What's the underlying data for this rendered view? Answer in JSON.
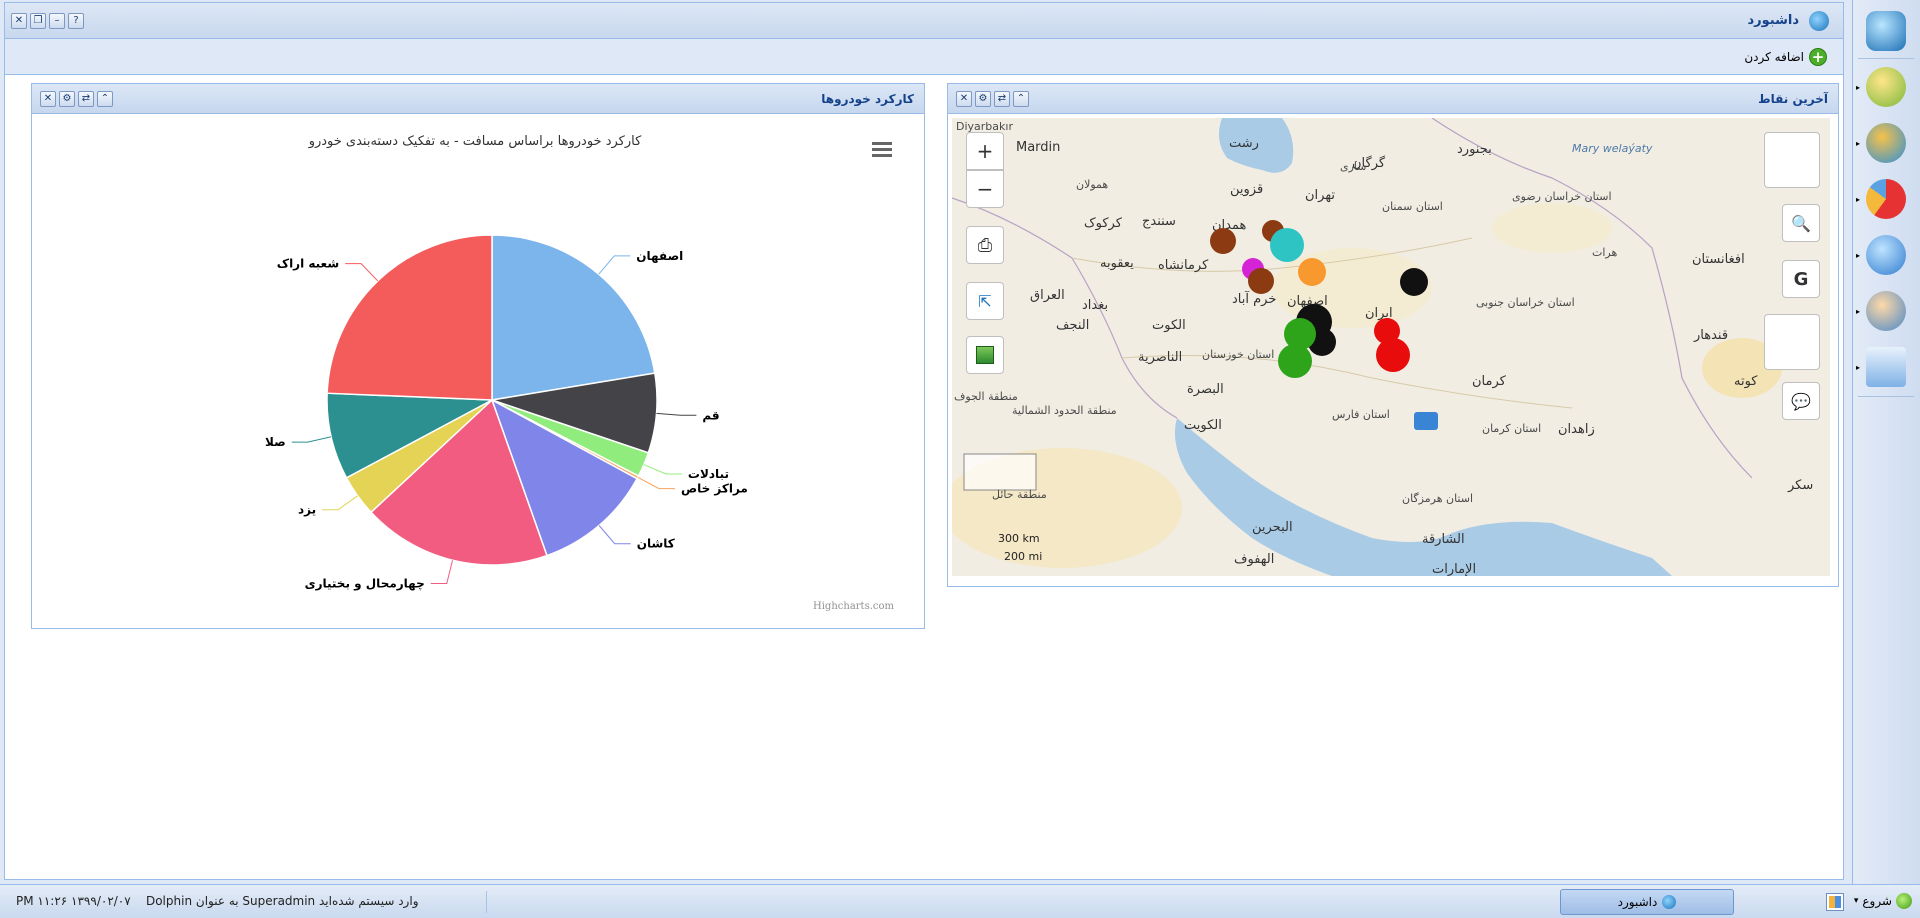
{
  "window": {
    "title": "داشبورد"
  },
  "toolbar": {
    "add_label": "اضافه کردن"
  },
  "portlets": {
    "map": {
      "title": "آخرین نقاط"
    },
    "chart": {
      "title": "کارکرد خودروها"
    }
  },
  "map": {
    "zoom_in": "+",
    "zoom_out": "−",
    "google_label": "G",
    "scale_km": "300 km",
    "scale_mi": "200 mi",
    "labels": [
      "Diyarbakır",
      "Mardin",
      "Mary welaýaty",
      "گرگان",
      "بجنورد",
      "ساری",
      "رشت",
      "قزوین",
      "تهران",
      "همدان",
      "کرکوک",
      "سنندج",
      "یعقوبه",
      "کرمانشاه",
      "العراق",
      "بغداد",
      "خرم آباد",
      "اصفهان",
      "ایران",
      "النجف",
      "الکوت",
      "الناصریة",
      "البصرة",
      "الکویت",
      "استان خوزستان",
      "کرمان",
      "زاهدان",
      "افغانستان",
      "هرات",
      "قندهار",
      "کوته",
      "استان خراسان رضوی",
      "استان خراسان جنوبی",
      "استان سمنان",
      "استان فارس",
      "استان کرمان",
      "استان هرمزگان",
      "البحرين",
      "الشارقة",
      "الهفوف",
      "الإمارات",
      "سکر",
      "منطقة حائل",
      "منطقة الحدود الشمالية",
      "منطقة الجوف",
      "همولان"
    ]
  },
  "chart_data": {
    "type": "pie",
    "title": "کارکرد خودروها براساس مسافت - به تفکیک دسته‌بندی خودرو",
    "credit": "Highcharts.com",
    "series": [
      {
        "name": "اصفهان",
        "value": 23,
        "color": "#7cb5ec"
      },
      {
        "name": "قم",
        "value": 8,
        "color": "#434348"
      },
      {
        "name": "تبادلات",
        "value": 2.5,
        "color": "#90ed7d"
      },
      {
        "name": "مراکز خاص",
        "value": 0.3,
        "color": "#f7a35c"
      },
      {
        "name": "کاشان",
        "value": 12,
        "color": "#8085e9"
      },
      {
        "name": "چهارمحال و بختیاری",
        "value": 19,
        "color": "#f15c80"
      },
      {
        "name": "یزد",
        "value": 4.2,
        "color": "#e4d354"
      },
      {
        "name": "صلا",
        "value": 8.7,
        "color": "#2b908f"
      },
      {
        "name": "شعبه اراک",
        "value": 25,
        "color": "#f45b5b"
      }
    ]
  },
  "launcher": {
    "items": [
      "app-logo",
      "users-icon",
      "globe-icon",
      "pie-chart-icon",
      "media-icon",
      "user-settings-icon",
      "messages-icon"
    ]
  },
  "taskbar": {
    "start_label": "شروع",
    "task_label": "داشبورد",
    "status": "PM ۱۱:۲۶ ۱۳۹۹/۰۲/۰۷",
    "login_message": "Dolphin به عنوان Superadmin وارد سیستم شده‌اید"
  }
}
